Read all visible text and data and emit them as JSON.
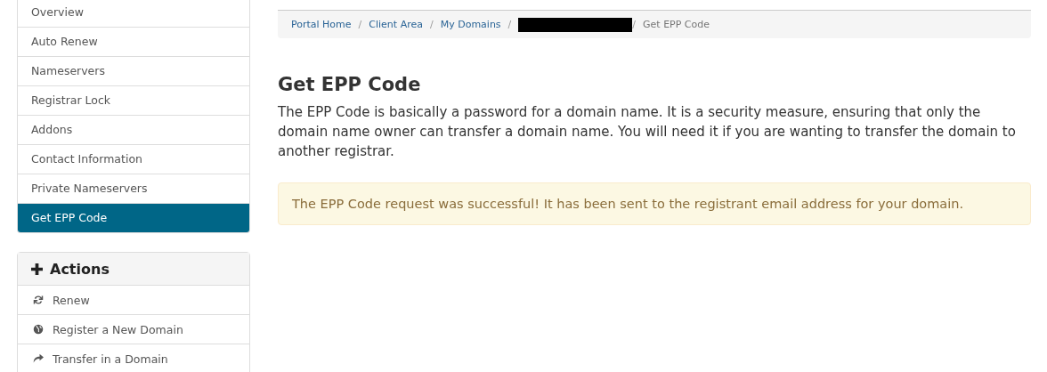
{
  "sidebar": {
    "menu": [
      {
        "label": "Overview",
        "selected": false
      },
      {
        "label": "Auto Renew",
        "selected": false
      },
      {
        "label": "Nameservers",
        "selected": false
      },
      {
        "label": "Registrar Lock",
        "selected": false
      },
      {
        "label": "Addons",
        "selected": false
      },
      {
        "label": "Contact Information",
        "selected": false
      },
      {
        "label": "Private Nameservers",
        "selected": false
      },
      {
        "label": "Get EPP Code",
        "selected": true
      }
    ],
    "actions": {
      "title": "Actions",
      "items": [
        {
          "label": "Renew"
        },
        {
          "label": "Register a New Domain"
        },
        {
          "label": "Transfer in a Domain"
        }
      ]
    }
  },
  "breadcrumb": [
    {
      "kind": "link",
      "label": "Portal Home"
    },
    {
      "kind": "link",
      "label": "Client Area",
      "separator": "/"
    },
    {
      "kind": "link",
      "label": "My Domains",
      "separator": "/"
    },
    {
      "kind": "redacted",
      "separator": "/"
    },
    {
      "kind": "current",
      "label": "Get EPP Code",
      "separator": "/"
    }
  ],
  "heading": "Get EPP Code",
  "description": "The EPP Code is basically a password for a domain name. It is a security measure, ensuring that only the domain name owner can transfer a domain name. You will need it if you are wanting to transfer the domain to another registrar.",
  "alert": {
    "kind": "warning",
    "text": "The EPP Code request was successful! It has been sent to the registrant email address for your domain."
  }
}
